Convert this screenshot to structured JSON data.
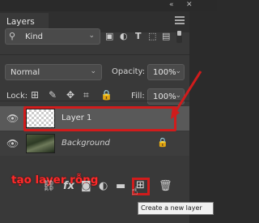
{
  "window": {
    "collapse_icon": "double-chevron",
    "close_icon": "close-x"
  },
  "panel": {
    "tab_label": "Layers",
    "menu_icon": "hamburger-menu"
  },
  "filter": {
    "kind_label": "Kind",
    "icons": [
      "image-filter-icon",
      "adjustment-filter-icon",
      "type-filter-icon",
      "shape-filter-icon",
      "smart-object-filter-icon"
    ]
  },
  "blend": {
    "mode": "Normal",
    "opacity_label": "Opacity:",
    "opacity_value": "100%"
  },
  "lock": {
    "label": "Lock:",
    "fill_label": "Fill:",
    "fill_value": "100%"
  },
  "layers": [
    {
      "name": "Layer 1",
      "selected": true
    },
    {
      "name": "Background",
      "locked": true
    }
  ],
  "annotation": {
    "text": "tạo layer rỗng",
    "color": "#ff2a2a"
  },
  "tooltip": {
    "text": "Create a new layer"
  },
  "colors": {
    "panel_bg": "#393939",
    "selected_layer": "#595959",
    "highlight": "#d01c1c"
  }
}
